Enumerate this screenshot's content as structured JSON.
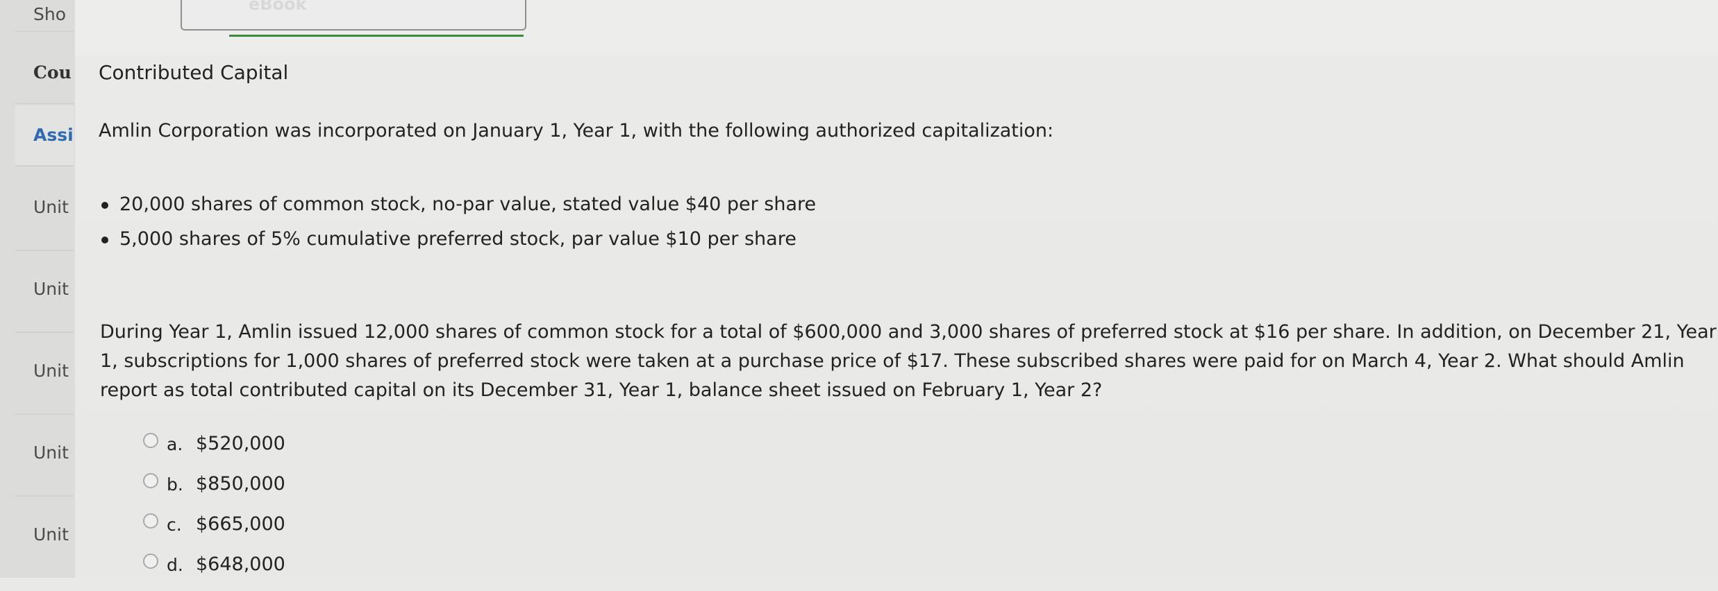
{
  "sidebar": {
    "items": [
      {
        "label": "Sho",
        "kind": "show"
      },
      {
        "label": "Cou",
        "kind": "course"
      },
      {
        "label": "Assi",
        "kind": "assign"
      },
      {
        "label": "Unit",
        "kind": "unit"
      },
      {
        "label": "Unit",
        "kind": "unit"
      },
      {
        "label": "Unit",
        "kind": "unit"
      },
      {
        "label": "Unit",
        "kind": "unit"
      },
      {
        "label": "Unit",
        "kind": "unit"
      }
    ]
  },
  "toolbar": {
    "ebook_label": "eBook"
  },
  "main": {
    "title": "Contributed Capital",
    "intro": "Amlin Corporation was incorporated on January 1, Year 1, with the following authorized capitalization:",
    "bullets": [
      "20,000 shares of common stock, no-par value, stated value $40 per share",
      "5,000 shares of 5% cumulative preferred stock, par value $10 per share"
    ],
    "question": "During Year 1, Amlin issued 12,000 shares of common stock for a total of $600,000 and 3,000 shares of preferred stock at $16 per share. In addition, on December 21, Year 1, subscriptions for 1,000 shares of preferred stock were taken at a purchase price of $17. These subscribed shares were paid for on March 4, Year 2. What should Amlin report as total contributed capital on its December 31, Year 1, balance sheet issued on February 1, Year 2?",
    "options": [
      {
        "letter": "a.",
        "value": "$520,000"
      },
      {
        "letter": "b.",
        "value": "$850,000"
      },
      {
        "letter": "c.",
        "value": "$665,000"
      },
      {
        "letter": "d.",
        "value": "$648,000"
      }
    ]
  },
  "colors": {
    "accent_link": "#2f6cb4",
    "ebook_underline": "#3d8a3d"
  }
}
